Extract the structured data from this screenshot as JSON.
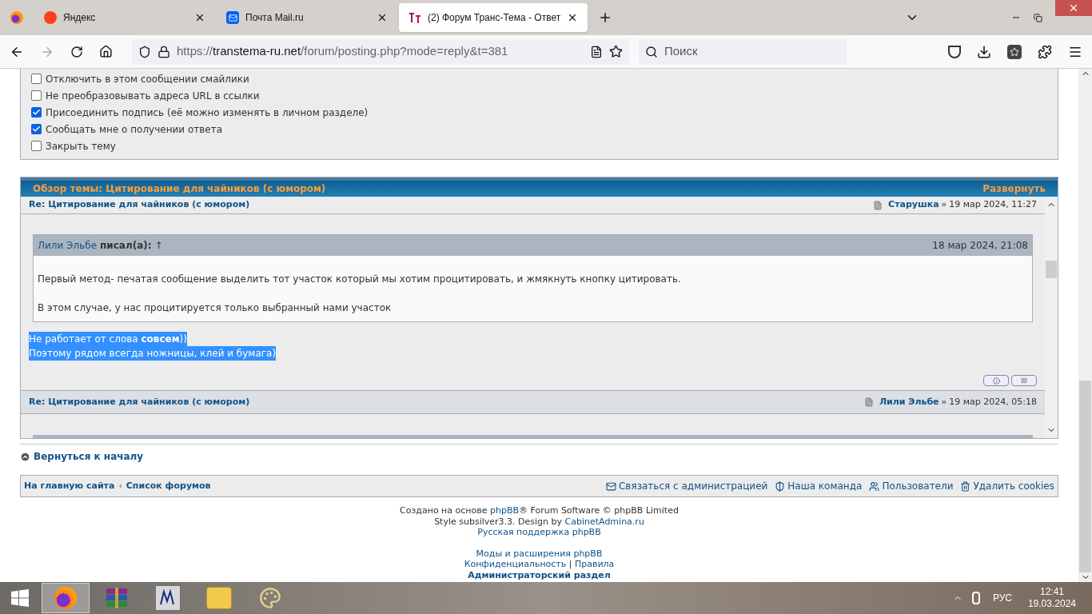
{
  "browser": {
    "tabs": [
      {
        "title": "Яндекс",
        "selected": false
      },
      {
        "title": "Почта Mail.ru",
        "selected": false
      },
      {
        "title": "(2) Форум Транс-Тема - Ответ",
        "selected": true
      }
    ],
    "url": {
      "scheme": "https://",
      "host": "transtema-ru.net",
      "path": "/forum/posting.php?mode=reply&t=381"
    },
    "search_placeholder": "Поиск"
  },
  "options": [
    {
      "label": "Отключить в этом сообщении смайлики",
      "checked": false
    },
    {
      "label": "Не преобразовывать адреса URL в ссылки",
      "checked": false
    },
    {
      "label": "Присоединить подпись (её можно изменять в личном разделе)",
      "checked": true
    },
    {
      "label": "Сообщать мне о получении ответа",
      "checked": true
    },
    {
      "label": "Закрыть тему",
      "checked": false
    }
  ],
  "review": {
    "title": "Обзор темы: Цитирование для чайников (с юмором)",
    "expand": "Развернуть",
    "posts": [
      {
        "subject": "Re: Цитирование для чайников (с юмором)",
        "author": "Старушка",
        "sep": "»",
        "date": "19 мар 2024, 11:27",
        "quote": {
          "author": "Лили Эльбе",
          "wrote": "писал(а):",
          "arrow": "↑",
          "date": "18 мар 2024, 21:08",
          "paragraphs": [
            "Первый метод- печатая сообщение выделить тот участок который мы хотим процитировать, и жмякнуть кнопку цитировать.",
            "В этом случае, у нас процитируется только выбранный нами участок"
          ]
        },
        "lines": [
          {
            "text": "Не работает от слова **совсем**))",
            "selected": true
          },
          {
            "text": "Поэтому рядом всегда ножницы, клей и бумага)",
            "selected": true
          }
        ]
      },
      {
        "subject": "Re: Цитирование для чайников (с юмором)",
        "author": "Лили Эльбе",
        "sep": "»",
        "date": "19 мар 2024, 05:18"
      }
    ]
  },
  "back_to_top": "Вернуться к началу",
  "nav": {
    "left": [
      "На главную сайта",
      "Список форумов"
    ],
    "separator": "‹",
    "right": [
      "Связаться с администрацией",
      "Наша команда",
      "Пользователи",
      "Удалить cookies"
    ]
  },
  "footer": [
    [
      {
        "text": "Создано на основе ",
        "kind": "plain"
      },
      {
        "text": "phpBB",
        "kind": "link"
      },
      {
        "text": "® Forum Software © phpBB Limited",
        "kind": "plain"
      }
    ],
    [
      {
        "text": "Style subsilver3.3. Design by ",
        "kind": "plain"
      },
      {
        "text": "CabinetAdmina.ru",
        "kind": "link"
      }
    ],
    [
      {
        "text": "Русская поддержка phpBB",
        "kind": "link"
      }
    ],
    [
      {
        "text": "Моды и расширения phpBB",
        "kind": "link"
      }
    ],
    [
      {
        "text": "Конфиденциальность",
        "kind": "link"
      },
      {
        "text": " | ",
        "kind": "plain"
      },
      {
        "text": "Правила",
        "kind": "link"
      }
    ],
    [
      {
        "text": "Администраторский раздел",
        "kind": "bold"
      }
    ]
  ],
  "taskbar": {
    "apps": [
      {
        "kind": "firefox",
        "selected": true
      },
      {
        "kind": "archive",
        "selected": false
      },
      {
        "kind": "editor",
        "selected": false
      },
      {
        "kind": "folder",
        "selected": false
      },
      {
        "kind": "paint",
        "selected": false
      }
    ],
    "lang": "РУС",
    "time": "12:41",
    "date": "19.03.2024"
  }
}
